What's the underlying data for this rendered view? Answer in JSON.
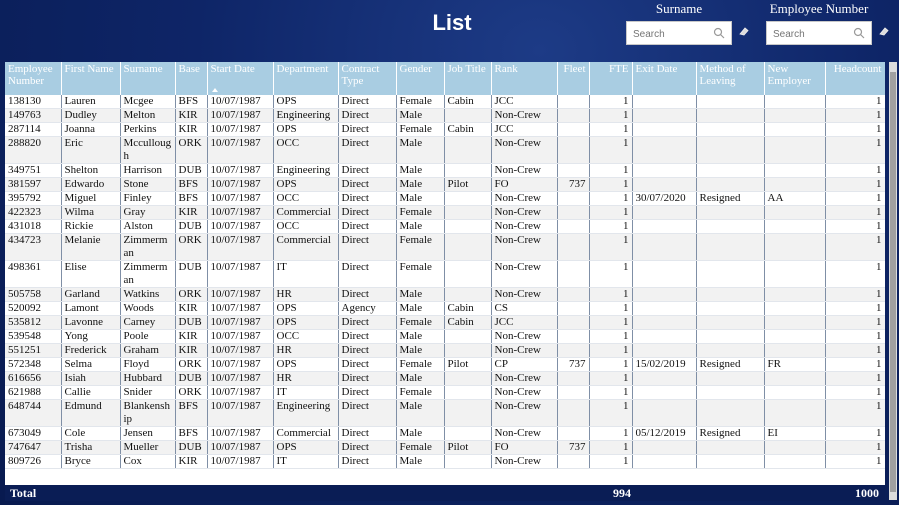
{
  "title": "List",
  "slicers": [
    {
      "label": "Surname",
      "placeholder": "Search"
    },
    {
      "label": "Employee Number",
      "placeholder": "Search"
    }
  ],
  "columns": [
    "Employee Number",
    "First Name",
    "Surname",
    "Base",
    "Start Date",
    "Department",
    "Contract Type",
    "Gender",
    "Job Title",
    "Rank",
    "Fleet",
    "FTE",
    "Exit Date",
    "Method of Leaving",
    "New Employer",
    "Headcount"
  ],
  "rows": [
    [
      "138130",
      "Lauren",
      "Mcgee",
      "BFS",
      "10/07/1987",
      "OPS",
      "Direct",
      "Female",
      "Cabin",
      "JCC",
      "",
      "1",
      "",
      "",
      "",
      "1"
    ],
    [
      "149763",
      "Dudley",
      "Melton",
      "KIR",
      "10/07/1987",
      "Engineering",
      "Direct",
      "Male",
      "",
      "Non-Crew",
      "",
      "1",
      "",
      "",
      "",
      "1"
    ],
    [
      "287114",
      "Joanna",
      "Perkins",
      "KIR",
      "10/07/1987",
      "OPS",
      "Direct",
      "Female",
      "Cabin",
      "JCC",
      "",
      "1",
      "",
      "",
      "",
      "1"
    ],
    [
      "288820",
      "Eric",
      "Mccullough",
      "ORK",
      "10/07/1987",
      "OCC",
      "Direct",
      "Male",
      "",
      "Non-Crew",
      "",
      "1",
      "",
      "",
      "",
      "1"
    ],
    [
      "349751",
      "Shelton",
      "Harrison",
      "DUB",
      "10/07/1987",
      "Engineering",
      "Direct",
      "Male",
      "",
      "Non-Crew",
      "",
      "1",
      "",
      "",
      "",
      "1"
    ],
    [
      "381597",
      "Edwardo",
      "Stone",
      "BFS",
      "10/07/1987",
      "OPS",
      "Direct",
      "Male",
      "Pilot",
      "FO",
      "737",
      "1",
      "",
      "",
      "",
      "1"
    ],
    [
      "395792",
      "Miguel",
      "Finley",
      "BFS",
      "10/07/1987",
      "OCC",
      "Direct",
      "Male",
      "",
      "Non-Crew",
      "",
      "1",
      "30/07/2020",
      "Resigned",
      "AA",
      "1"
    ],
    [
      "422323",
      "Wilma",
      "Gray",
      "KIR",
      "10/07/1987",
      "Commercial",
      "Direct",
      "Female",
      "",
      "Non-Crew",
      "",
      "1",
      "",
      "",
      "",
      "1"
    ],
    [
      "431018",
      "Rickie",
      "Alston",
      "DUB",
      "10/07/1987",
      "OCC",
      "Direct",
      "Male",
      "",
      "Non-Crew",
      "",
      "1",
      "",
      "",
      "",
      "1"
    ],
    [
      "434723",
      "Melanie",
      "Zimmerman",
      "ORK",
      "10/07/1987",
      "Commercial",
      "Direct",
      "Female",
      "",
      "Non-Crew",
      "",
      "1",
      "",
      "",
      "",
      "1"
    ],
    [
      "498361",
      "Elise",
      "Zimmerman",
      "DUB",
      "10/07/1987",
      "IT",
      "Direct",
      "Female",
      "",
      "Non-Crew",
      "",
      "1",
      "",
      "",
      "",
      "1"
    ],
    [
      "505758",
      "Garland",
      "Watkins",
      "ORK",
      "10/07/1987",
      "HR",
      "Direct",
      "Male",
      "",
      "Non-Crew",
      "",
      "1",
      "",
      "",
      "",
      "1"
    ],
    [
      "520092",
      "Lamont",
      "Woods",
      "KIR",
      "10/07/1987",
      "OPS",
      "Agency",
      "Male",
      "Cabin",
      "CS",
      "",
      "1",
      "",
      "",
      "",
      "1"
    ],
    [
      "535812",
      "Lavonne",
      "Carney",
      "DUB",
      "10/07/1987",
      "OPS",
      "Direct",
      "Female",
      "Cabin",
      "JCC",
      "",
      "1",
      "",
      "",
      "",
      "1"
    ],
    [
      "539548",
      "Yong",
      "Poole",
      "KIR",
      "10/07/1987",
      "OCC",
      "Direct",
      "Male",
      "",
      "Non-Crew",
      "",
      "1",
      "",
      "",
      "",
      "1"
    ],
    [
      "551251",
      "Frederick",
      "Graham",
      "KIR",
      "10/07/1987",
      "HR",
      "Direct",
      "Male",
      "",
      "Non-Crew",
      "",
      "1",
      "",
      "",
      "",
      "1"
    ],
    [
      "572348",
      "Selma",
      "Floyd",
      "ORK",
      "10/07/1987",
      "OPS",
      "Direct",
      "Female",
      "Pilot",
      "CP",
      "737",
      "1",
      "15/02/2019",
      "Resigned",
      "FR",
      "1"
    ],
    [
      "616656",
      "Isiah",
      "Hubbard",
      "DUB",
      "10/07/1987",
      "HR",
      "Direct",
      "Male",
      "",
      "Non-Crew",
      "",
      "1",
      "",
      "",
      "",
      "1"
    ],
    [
      "621988",
      "Callie",
      "Snider",
      "ORK",
      "10/07/1987",
      "IT",
      "Direct",
      "Female",
      "",
      "Non-Crew",
      "",
      "1",
      "",
      "",
      "",
      "1"
    ],
    [
      "648744",
      "Edmund",
      "Blankenship",
      "BFS",
      "10/07/1987",
      "Engineering",
      "Direct",
      "Male",
      "",
      "Non-Crew",
      "",
      "1",
      "",
      "",
      "",
      "1"
    ],
    [
      "673049",
      "Cole",
      "Jensen",
      "BFS",
      "10/07/1987",
      "Commercial",
      "Direct",
      "Male",
      "",
      "Non-Crew",
      "",
      "1",
      "05/12/2019",
      "Resigned",
      "EI",
      "1"
    ],
    [
      "747647",
      "Trisha",
      "Mueller",
      "DUB",
      "10/07/1987",
      "OPS",
      "Direct",
      "Female",
      "Pilot",
      "FO",
      "737",
      "1",
      "",
      "",
      "",
      "1"
    ],
    [
      "809726",
      "Bryce",
      "Cox",
      "KIR",
      "10/07/1987",
      "IT",
      "Direct",
      "Male",
      "",
      "Non-Crew",
      "",
      "1",
      "",
      "",
      "",
      "1"
    ]
  ],
  "totals": {
    "label": "Total",
    "fte": "994",
    "headcount": "1000"
  },
  "colors": {
    "header_bg": "#a9cde2",
    "page_bg": "#0e2567"
  }
}
